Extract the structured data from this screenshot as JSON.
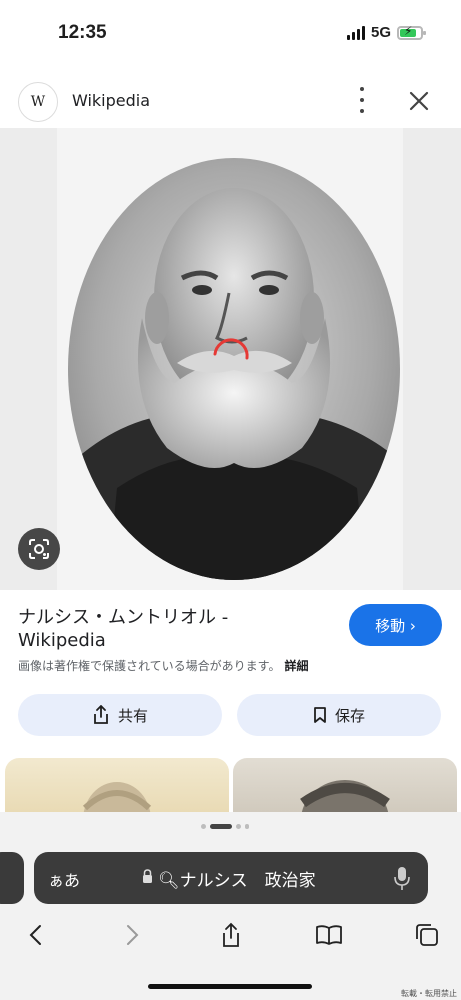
{
  "status_bar": {
    "time": "12:35",
    "network": "5G"
  },
  "header": {
    "site_logo": "W",
    "site_name": "Wikipedia"
  },
  "result": {
    "title": "ナルシス・ムントリオル - Wikipedia",
    "go_label": "移動 ›",
    "notice": "画像は著作権で保護されている場合があります。",
    "details_link": "詳細"
  },
  "actions": {
    "share_label": "共有",
    "save_label": "保存"
  },
  "browser": {
    "aa_label": "ぁあ",
    "query": "ナルシス　政治家"
  },
  "watermark": "転載・転用禁止",
  "colors": {
    "accent": "#1a73e8",
    "pill_bg": "#e8eefb",
    "address_bar": "#3b3b3b"
  }
}
